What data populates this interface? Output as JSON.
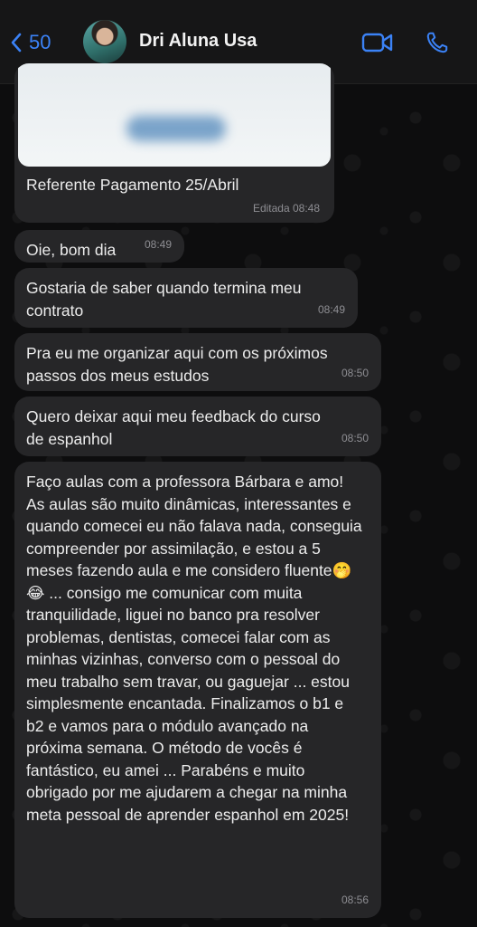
{
  "header": {
    "back_count": "50",
    "contact_name": "Dri Aluna Usa",
    "accent_color": "#3b82f6",
    "icons": [
      "chevron-left-icon",
      "video-call-icon",
      "phone-icon"
    ]
  },
  "messages": [
    {
      "type": "image",
      "caption": "Referente Pagamento 25/Abril",
      "time": "Editada 08:48"
    },
    {
      "text": "Oie, bom dia",
      "time": "08:49"
    },
    {
      "text": "Gostaria de saber quando termina meu contrato",
      "time": "08:49"
    },
    {
      "text": "Pra eu me organizar aqui com os próximos passos dos meus estudos",
      "time": "08:50"
    },
    {
      "text": "Quero deixar aqui meu feedback do curso de espanhol",
      "time": "08:50"
    },
    {
      "text": "Faço aulas com a professora Bárbara e amo! As aulas são muito dinâmicas, interessantes e quando comecei eu não falava nada, conseguia compreender por assimilação, e estou a 5 meses fazendo aula e me considero fluente🤭😂 ... consigo me comunicar com muita tranquilidade, liguei no banco pra resolver problemas, dentistas, comecei falar com as minhas vizinhas, converso com o pessoal do meu trabalho sem travar, ou gaguejar ... estou simplesmente encantada. Finalizamos o b1 e b2 e vamos para o módulo avançado na próxima semana. O método de vocês é fantástico, eu amei ... Parabéns e muito obrigado por me ajudarem a chegar na minha meta pessoal de aprender espanhol em 2025!",
      "time": "08:56"
    }
  ]
}
